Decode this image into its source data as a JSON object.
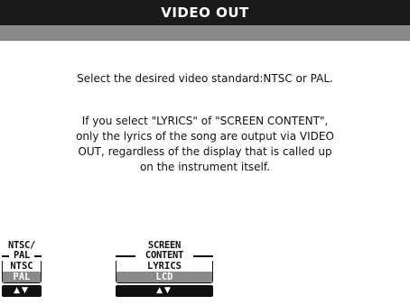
{
  "window": {
    "title": "VIDEO OUT"
  },
  "body": {
    "message_1": "Select the desired video standard:NTSC or PAL.",
    "message_2_lines": [
      "If you select \"LYRICS\" of \"SCREEN CONTENT\",",
      "only the lyrics of the song are output via VIDEO",
      "OUT, regardless of the display that is called up",
      "on the instrument itself."
    ]
  },
  "controls": {
    "ntsc_pal": {
      "title_line1": "NTSC/",
      "title_line2": "PAL",
      "options": [
        "NTSC",
        "PAL"
      ],
      "selected": "PAL",
      "arrows": "▲▼"
    },
    "screen_content": {
      "title_line1": "SCREEN",
      "title_line2": "CONTENT",
      "options": [
        "LYRICS",
        "LCD"
      ],
      "selected": "LCD",
      "arrows": "▲▼"
    }
  },
  "colors": {
    "title_bg": "#1a1a1a",
    "band": "#8a8a8a",
    "selected_bg": "#8a8a8a"
  }
}
